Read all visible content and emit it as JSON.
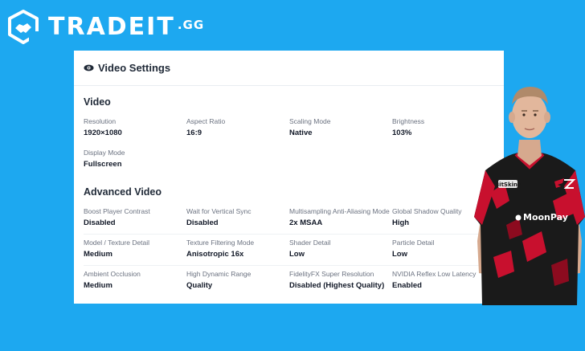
{
  "brand": {
    "name": "TRADEIT",
    "suffix": ".GG"
  },
  "card": {
    "title": "Video Settings",
    "sections": [
      {
        "title": "Video",
        "items": [
          {
            "label": "Resolution",
            "value": "1920×1080"
          },
          {
            "label": "Aspect Ratio",
            "value": "16:9"
          },
          {
            "label": "Scaling Mode",
            "value": "Native"
          },
          {
            "label": "Brightness",
            "value": "103%"
          },
          {
            "label": "Display Mode",
            "value": "Fullscreen"
          }
        ]
      },
      {
        "title": "Advanced Video",
        "items": [
          {
            "label": "Boost Player Contrast",
            "value": "Disabled"
          },
          {
            "label": "Wait for Vertical Sync",
            "value": "Disabled"
          },
          {
            "label": "Multisampling Anti-Aliasing Mode",
            "value": "2x MSAA"
          },
          {
            "label": "Global Shadow Quality",
            "value": "High"
          },
          {
            "label": "Model / Texture Detail",
            "value": "Medium"
          },
          {
            "label": "Texture Filtering Mode",
            "value": "Anisotropic 16x"
          },
          {
            "label": "Shader Detail",
            "value": "Low"
          },
          {
            "label": "Particle Detail",
            "value": "Low"
          },
          {
            "label": "Ambient Occlusion",
            "value": "Medium"
          },
          {
            "label": "High Dynamic Range",
            "value": "Quality"
          },
          {
            "label": "FidelityFX Super Resolution",
            "value": "Disabled (Highest Quality)"
          },
          {
            "label": "NVIDIA Reflex Low Latency",
            "value": "Enabled"
          }
        ]
      }
    ]
  },
  "jersey": {
    "sponsor": "MoonPay",
    "chest_logo": "BitSkins",
    "team_logo": "FaZe"
  },
  "colors": {
    "background": "#1da8f0",
    "card": "#ffffff",
    "jersey": "#1a1a1a",
    "jersey_accent": "#c8102e"
  }
}
